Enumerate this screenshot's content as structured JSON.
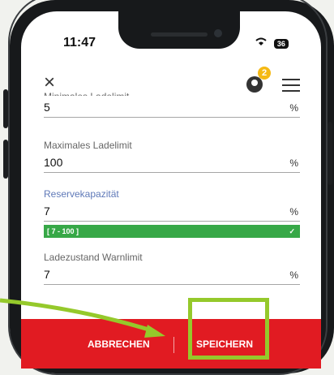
{
  "status_bar": {
    "time": "11:47",
    "wifi_icon": "wifi-icon",
    "battery": "36"
  },
  "header": {
    "close_icon": "×",
    "notification_count": "2",
    "menu_icon": "menu-icon"
  },
  "fields": [
    {
      "label": "Minimales Ladelimit",
      "value": "5",
      "unit": "%"
    },
    {
      "label": "Maximales Ladelimit",
      "value": "100",
      "unit": "%"
    },
    {
      "label": "Reservekapazität",
      "value": "7",
      "unit": "%",
      "range": "[ 7 - 100 ]",
      "valid": "✓"
    },
    {
      "label": "Ladezustand Warnlimit",
      "value": "7",
      "unit": "%"
    }
  ],
  "footer": {
    "cancel_label": "ABBRECHEN",
    "save_label": "SPEICHERN"
  },
  "colors": {
    "primary_red": "#e11b22",
    "highlight_green": "#95c92b",
    "success_green": "#37a847",
    "active_label_blue": "#5f79b8"
  }
}
